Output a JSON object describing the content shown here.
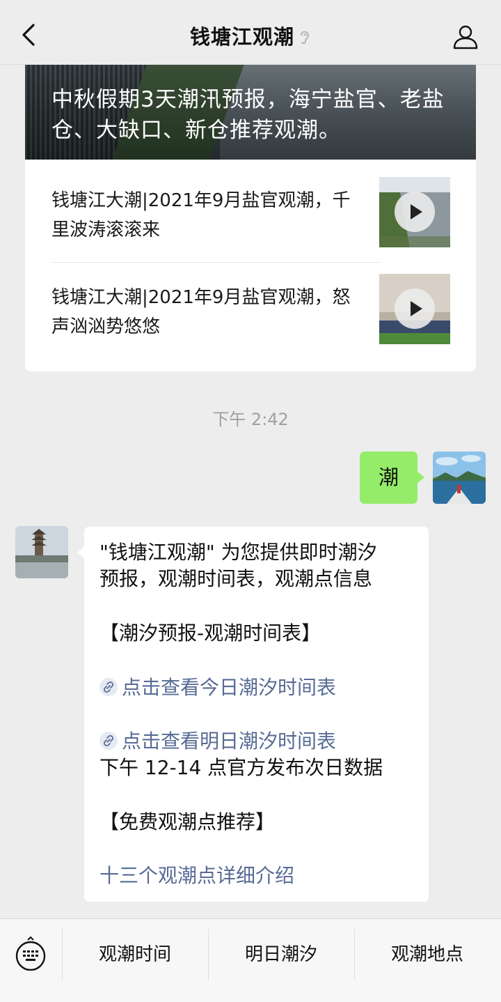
{
  "header": {
    "title": "钱塘江观潮",
    "back_icon": "chevron-left-icon",
    "ear_icon": "ear-icon",
    "profile_icon": "person-icon"
  },
  "article": {
    "cover_title": "中秋假期3天潮汛预报，海宁盐官、老盐仓、大缺口、新仓推荐观潮。",
    "items": [
      {
        "title": "钱塘江大潮|2021年9月盐官观潮，千里波涛滚滚来",
        "thumb_icon": "play-icon"
      },
      {
        "title": "钱塘江大潮|2021年9月盐官观潮，怒声汹汹势悠悠",
        "thumb_icon": "play-icon"
      }
    ]
  },
  "timestamp": "下午 2:42",
  "sent_message": "潮",
  "received_message": {
    "line1": "\"钱塘江观潮\" 为您提供即时潮汐",
    "line2": "预报，观潮时间表，观潮点信息",
    "section1": "【潮汐预报-观潮时间表】",
    "link1": "点击查看今日潮汐时间表",
    "link2": "点击查看明日潮汐时间表",
    "note": "下午 12-14 点官方发布次日数据",
    "section2": "【免费观潮点推荐】",
    "link3": "十三个观潮点详细介绍"
  },
  "bottom_menu": {
    "keyboard_icon": "keyboard-icon",
    "items": [
      "观潮时间",
      "明日潮汐",
      "观潮地点"
    ]
  },
  "colors": {
    "background": "#ededed",
    "sent_bubble": "#95ec69",
    "link": "#576b95"
  }
}
